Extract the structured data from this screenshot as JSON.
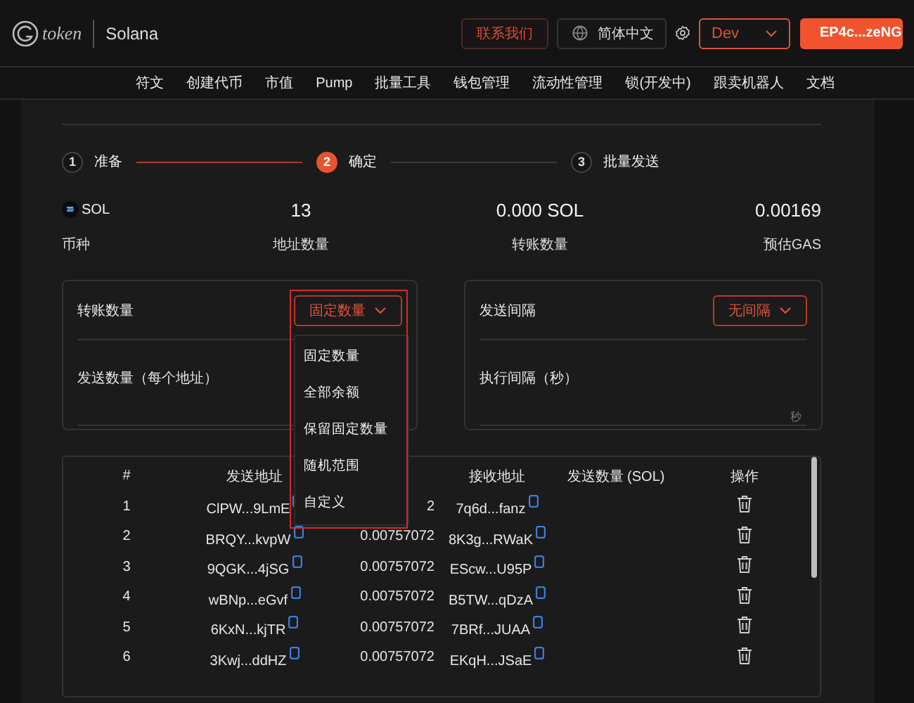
{
  "header": {
    "logo_text": "token",
    "network": "Solana",
    "contact_button": "联系我们",
    "language": "简体中文",
    "env_select": "Dev",
    "wallet_button": "EP4c...zeNG"
  },
  "nav": [
    "符文",
    "创建代币",
    "市值",
    "Pump",
    "批量工具",
    "钱包管理",
    "流动性管理",
    "锁(开发中)",
    "跟卖机器人",
    "文档"
  ],
  "steps": [
    {
      "number": "1",
      "label": "准备",
      "selected": false
    },
    {
      "number": "2",
      "label": "确定",
      "selected": true
    },
    {
      "number": "3",
      "label": "批量发送",
      "selected": false
    }
  ],
  "stats": [
    {
      "kind": "token",
      "value": "SOL",
      "label": "币种"
    },
    {
      "kind": "number",
      "value": "13",
      "label": "地址数量"
    },
    {
      "kind": "number",
      "value": "0.000 SOL",
      "label": "转账数量"
    },
    {
      "kind": "number",
      "value": "0.00169",
      "label": "预估GAS"
    }
  ],
  "amount_card": {
    "label": "转账数量",
    "select": "固定数量",
    "expanded": true,
    "options": [
      "固定数量",
      "全部余额",
      "保留固定数量",
      "随机范围",
      "自定义"
    ],
    "per_address_label": "发送数量（每个地址）"
  },
  "interval_card": {
    "label": "发送间隔",
    "select": "无间隔",
    "exec_label": "执行间隔（秒）",
    "unit": "秒"
  },
  "table": {
    "columns": [
      "#",
      "发送地址",
      "接收地址",
      "发送数量 (SOL)",
      "操作"
    ],
    "rows": [
      {
        "index": "1",
        "sender": "ClPW...9LmE",
        "column_3": "2",
        "receiver": "7q6d...fanz"
      },
      {
        "index": "2",
        "sender": "BRQY...kvpW",
        "column_3": "0.00757072",
        "receiver": "8K3g...RWaK"
      },
      {
        "index": "3",
        "sender": "9QGK...4jSG",
        "column_3": "0.00757072",
        "receiver": "EScw...U95P"
      },
      {
        "index": "4",
        "sender": "wBNp...eGvf",
        "column_3": "0.00757072",
        "receiver": "B5TW...qDzA"
      },
      {
        "index": "5",
        "sender": "6KxN...kjTR",
        "column_3": "0.00757072",
        "receiver": "7BRf...JUAA"
      },
      {
        "index": "6",
        "sender": "3Kwj...ddHZ",
        "column_3": "0.00757072",
        "receiver": "EKqH...JSaE"
      }
    ]
  }
}
